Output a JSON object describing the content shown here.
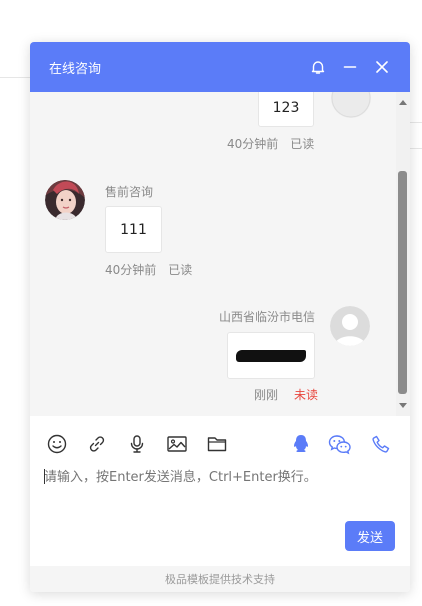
{
  "header": {
    "title": "在线咨询",
    "bell_icon": "bell-icon",
    "minimize_icon": "minimize-icon",
    "close_icon": "close-icon",
    "color": "#5b7cf8"
  },
  "messages": [
    {
      "side": "right",
      "text": "123",
      "time": "40分钟前",
      "status": "已读"
    },
    {
      "side": "left",
      "sender": "售前咨询",
      "text": "111",
      "time": "40分钟前",
      "status": "已读"
    },
    {
      "side": "right",
      "sender": "山西省临汾市电信",
      "text": "",
      "time": "刚刚",
      "status": "未读"
    }
  ],
  "toolbar": {
    "left_icons": [
      "emoji-icon",
      "link-icon",
      "microphone-icon",
      "image-icon",
      "folder-icon"
    ],
    "right_icons": [
      "qq-icon",
      "wechat-icon",
      "phone-icon"
    ]
  },
  "input": {
    "placeholder": "请输入，按Enter发送消息，Ctrl+Enter换行。"
  },
  "send_label": "发送",
  "footer_text": "极品模板提供技术支持",
  "colors": {
    "accent": "#5b7cf8",
    "unread": "#e8453c"
  }
}
